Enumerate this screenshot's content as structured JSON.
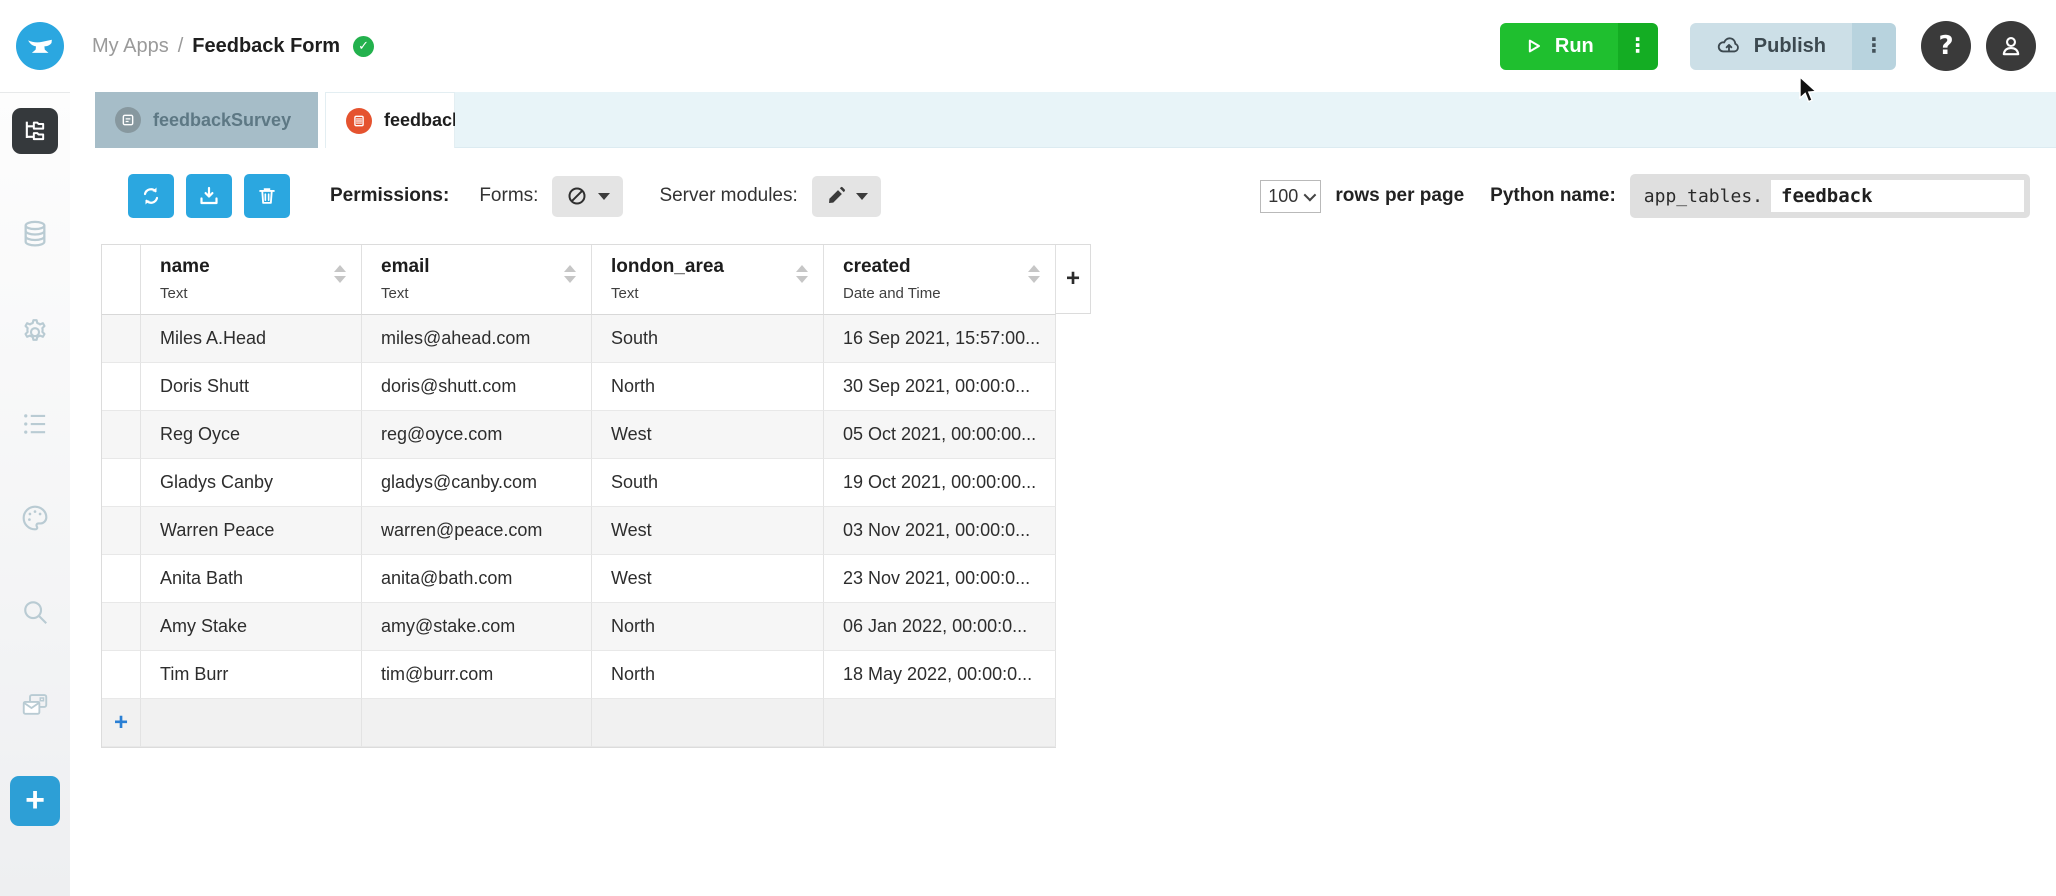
{
  "header": {
    "breadcrumb": {
      "section": "My Apps",
      "separator": "/",
      "app_name": "Feedback Form"
    },
    "run_label": "Run",
    "publish_label": "Publish",
    "icons": [
      "anvil-logo",
      "verified-check-icon",
      "play-icon",
      "kebab-menu-icon",
      "cloud-upload-icon",
      "help-icon",
      "user-icon"
    ]
  },
  "tabs": [
    {
      "label": "feedbackSurvey",
      "active": false,
      "icon": "form-icon"
    },
    {
      "label": "feedback",
      "active": true,
      "icon": "data-table-icon",
      "close": "×"
    }
  ],
  "sidebar": {
    "icons": [
      "app-browser-icon",
      "database-icon",
      "gear-icon",
      "list-icon",
      "palette-icon",
      "search-icon",
      "services-icon",
      "add-icon"
    ]
  },
  "toolbar": {
    "permissions_label": "Permissions:",
    "forms_label": "Forms:",
    "server_modules_label": "Server modules:",
    "rows_per_page_value": "100",
    "rows_per_page_label": "rows per page",
    "python_name_label": "Python name:",
    "python_prefix": "app_tables.",
    "python_value": "feedback",
    "icons": [
      "refresh-icon",
      "download-icon",
      "trash-icon",
      "no-entry-icon",
      "pencil-icon"
    ]
  },
  "table": {
    "columns": [
      {
        "name": "name",
        "type": "Text"
      },
      {
        "name": "email",
        "type": "Text"
      },
      {
        "name": "london_area",
        "type": "Text"
      },
      {
        "name": "created",
        "type": "Date and Time"
      }
    ],
    "rows": [
      [
        "Miles A.Head",
        "miles@ahead.com",
        "South",
        "16 Sep 2021, 15:57:00..."
      ],
      [
        "Doris Shutt",
        "doris@shutt.com",
        "North",
        "30 Sep 2021, 00:00:0..."
      ],
      [
        "Reg Oyce",
        "reg@oyce.com",
        "West",
        "05 Oct 2021, 00:00:00..."
      ],
      [
        "Gladys Canby",
        "gladys@canby.com",
        "South",
        "19 Oct 2021, 00:00:00..."
      ],
      [
        "Warren Peace",
        "warren@peace.com",
        "West",
        "03 Nov 2021, 00:00:0..."
      ],
      [
        "Anita Bath",
        "anita@bath.com",
        "West",
        "23 Nov 2021, 00:00:0..."
      ],
      [
        "Amy Stake",
        "amy@stake.com",
        "North",
        "06 Jan 2022, 00:00:0..."
      ],
      [
        "Tim Burr",
        "tim@burr.com",
        "North",
        "18 May 2022, 00:00:0..."
      ]
    ],
    "add_column_label": "+",
    "add_row_label": "+"
  },
  "colors": {
    "accent_blue": "#2ba7e0",
    "run_green": "#1fbf2f",
    "publish_gray_blue": "#ccdfe7",
    "tab_inactive": "#a6bdc8",
    "tab_icon_orange": "#e5532f",
    "strip_blue": "#e8f4f8",
    "row_stripe": "#f6f6f6"
  }
}
